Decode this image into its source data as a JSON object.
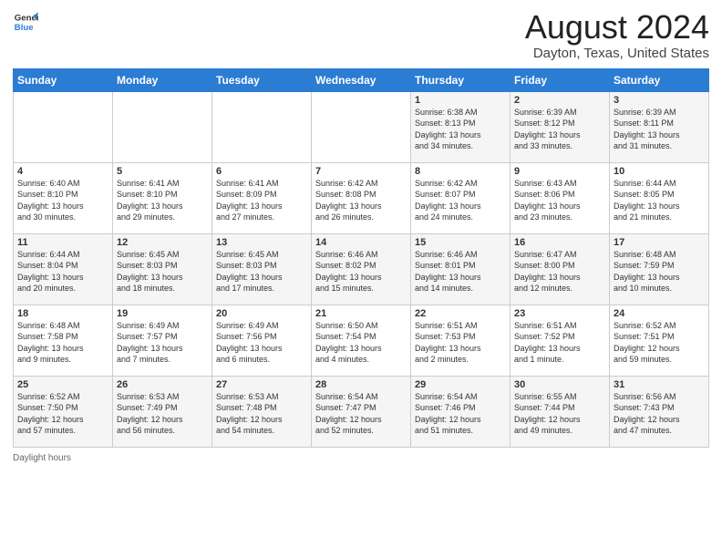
{
  "header": {
    "logo_line1": "General",
    "logo_line2": "Blue",
    "title": "August 2024",
    "location": "Dayton, Texas, United States"
  },
  "days_of_week": [
    "Sunday",
    "Monday",
    "Tuesday",
    "Wednesday",
    "Thursday",
    "Friday",
    "Saturday"
  ],
  "weeks": [
    [
      {
        "day": "",
        "info": ""
      },
      {
        "day": "",
        "info": ""
      },
      {
        "day": "",
        "info": ""
      },
      {
        "day": "",
        "info": ""
      },
      {
        "day": "1",
        "info": "Sunrise: 6:38 AM\nSunset: 8:13 PM\nDaylight: 13 hours\nand 34 minutes."
      },
      {
        "day": "2",
        "info": "Sunrise: 6:39 AM\nSunset: 8:12 PM\nDaylight: 13 hours\nand 33 minutes."
      },
      {
        "day": "3",
        "info": "Sunrise: 6:39 AM\nSunset: 8:11 PM\nDaylight: 13 hours\nand 31 minutes."
      }
    ],
    [
      {
        "day": "4",
        "info": "Sunrise: 6:40 AM\nSunset: 8:10 PM\nDaylight: 13 hours\nand 30 minutes."
      },
      {
        "day": "5",
        "info": "Sunrise: 6:41 AM\nSunset: 8:10 PM\nDaylight: 13 hours\nand 29 minutes."
      },
      {
        "day": "6",
        "info": "Sunrise: 6:41 AM\nSunset: 8:09 PM\nDaylight: 13 hours\nand 27 minutes."
      },
      {
        "day": "7",
        "info": "Sunrise: 6:42 AM\nSunset: 8:08 PM\nDaylight: 13 hours\nand 26 minutes."
      },
      {
        "day": "8",
        "info": "Sunrise: 6:42 AM\nSunset: 8:07 PM\nDaylight: 13 hours\nand 24 minutes."
      },
      {
        "day": "9",
        "info": "Sunrise: 6:43 AM\nSunset: 8:06 PM\nDaylight: 13 hours\nand 23 minutes."
      },
      {
        "day": "10",
        "info": "Sunrise: 6:44 AM\nSunset: 8:05 PM\nDaylight: 13 hours\nand 21 minutes."
      }
    ],
    [
      {
        "day": "11",
        "info": "Sunrise: 6:44 AM\nSunset: 8:04 PM\nDaylight: 13 hours\nand 20 minutes."
      },
      {
        "day": "12",
        "info": "Sunrise: 6:45 AM\nSunset: 8:03 PM\nDaylight: 13 hours\nand 18 minutes."
      },
      {
        "day": "13",
        "info": "Sunrise: 6:45 AM\nSunset: 8:03 PM\nDaylight: 13 hours\nand 17 minutes."
      },
      {
        "day": "14",
        "info": "Sunrise: 6:46 AM\nSunset: 8:02 PM\nDaylight: 13 hours\nand 15 minutes."
      },
      {
        "day": "15",
        "info": "Sunrise: 6:46 AM\nSunset: 8:01 PM\nDaylight: 13 hours\nand 14 minutes."
      },
      {
        "day": "16",
        "info": "Sunrise: 6:47 AM\nSunset: 8:00 PM\nDaylight: 13 hours\nand 12 minutes."
      },
      {
        "day": "17",
        "info": "Sunrise: 6:48 AM\nSunset: 7:59 PM\nDaylight: 13 hours\nand 10 minutes."
      }
    ],
    [
      {
        "day": "18",
        "info": "Sunrise: 6:48 AM\nSunset: 7:58 PM\nDaylight: 13 hours\nand 9 minutes."
      },
      {
        "day": "19",
        "info": "Sunrise: 6:49 AM\nSunset: 7:57 PM\nDaylight: 13 hours\nand 7 minutes."
      },
      {
        "day": "20",
        "info": "Sunrise: 6:49 AM\nSunset: 7:56 PM\nDaylight: 13 hours\nand 6 minutes."
      },
      {
        "day": "21",
        "info": "Sunrise: 6:50 AM\nSunset: 7:54 PM\nDaylight: 13 hours\nand 4 minutes."
      },
      {
        "day": "22",
        "info": "Sunrise: 6:51 AM\nSunset: 7:53 PM\nDaylight: 13 hours\nand 2 minutes."
      },
      {
        "day": "23",
        "info": "Sunrise: 6:51 AM\nSunset: 7:52 PM\nDaylight: 13 hours\nand 1 minute."
      },
      {
        "day": "24",
        "info": "Sunrise: 6:52 AM\nSunset: 7:51 PM\nDaylight: 12 hours\nand 59 minutes."
      }
    ],
    [
      {
        "day": "25",
        "info": "Sunrise: 6:52 AM\nSunset: 7:50 PM\nDaylight: 12 hours\nand 57 minutes."
      },
      {
        "day": "26",
        "info": "Sunrise: 6:53 AM\nSunset: 7:49 PM\nDaylight: 12 hours\nand 56 minutes."
      },
      {
        "day": "27",
        "info": "Sunrise: 6:53 AM\nSunset: 7:48 PM\nDaylight: 12 hours\nand 54 minutes."
      },
      {
        "day": "28",
        "info": "Sunrise: 6:54 AM\nSunset: 7:47 PM\nDaylight: 12 hours\nand 52 minutes."
      },
      {
        "day": "29",
        "info": "Sunrise: 6:54 AM\nSunset: 7:46 PM\nDaylight: 12 hours\nand 51 minutes."
      },
      {
        "day": "30",
        "info": "Sunrise: 6:55 AM\nSunset: 7:44 PM\nDaylight: 12 hours\nand 49 minutes."
      },
      {
        "day": "31",
        "info": "Sunrise: 6:56 AM\nSunset: 7:43 PM\nDaylight: 12 hours\nand 47 minutes."
      }
    ]
  ],
  "footer": {
    "label": "Daylight hours"
  }
}
